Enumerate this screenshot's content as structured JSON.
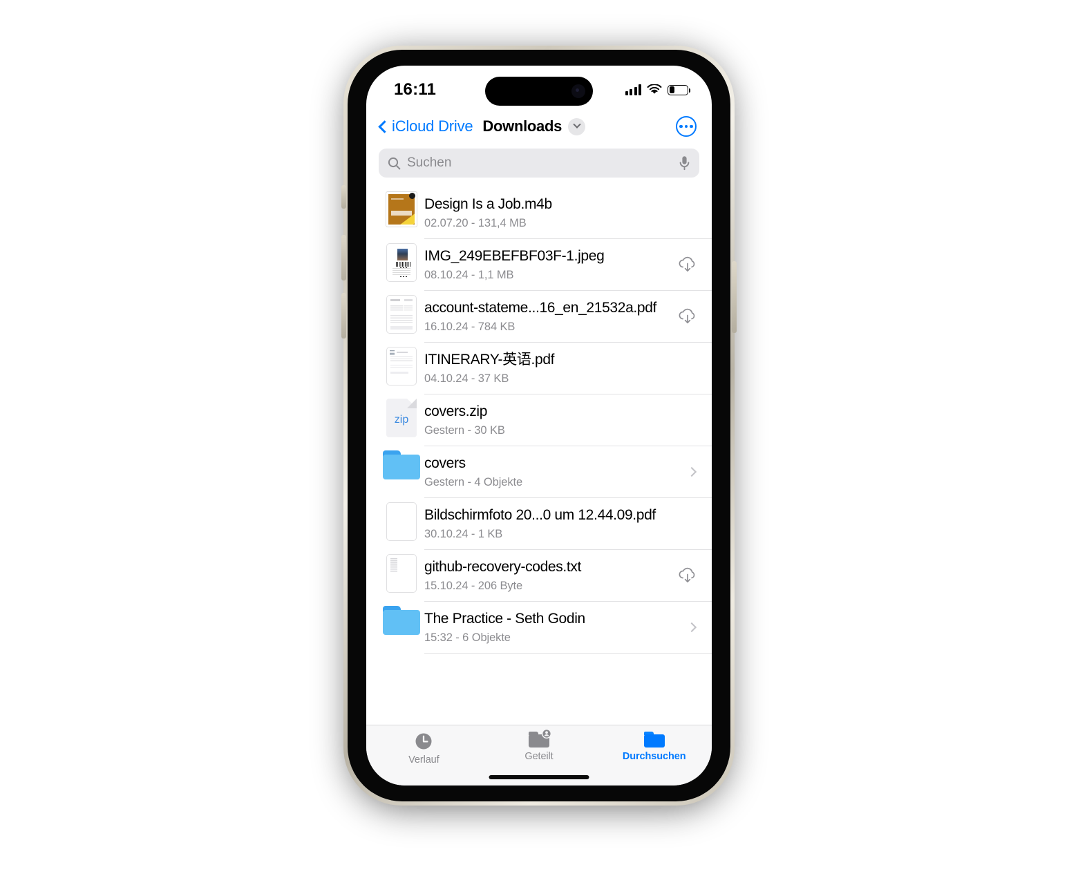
{
  "status_bar": {
    "time": "16:11",
    "signal_icon": "cellular-bars-icon",
    "wifi_icon": "wifi-icon",
    "battery_icon": "battery-icon",
    "battery_level_pct": 28
  },
  "nav": {
    "back_label": "iCloud Drive",
    "back_icon": "chevron-left-icon",
    "title": "Downloads",
    "title_chevron_icon": "chevron-down-icon",
    "more_icon": "ellipsis-circle-icon"
  },
  "search": {
    "placeholder": "Suchen",
    "search_icon": "search-icon",
    "mic_icon": "microphone-icon"
  },
  "files": [
    {
      "name": "Design Is a Job.m4b",
      "meta": "02.07.20 - 131,4 MB",
      "thumb": "audiobook-cover-thumbnail",
      "accessory": "none"
    },
    {
      "name": "IMG_249EBEFBF03F-1.jpeg",
      "meta": "08.10.24 - 1,1 MB",
      "thumb": "image-preview-thumbnail",
      "accessory": "cloud-download-icon"
    },
    {
      "name": "account-stateme...16_en_21532a.pdf",
      "meta": "16.10.24 - 784 KB",
      "thumb": "pdf-preview-thumbnail",
      "accessory": "cloud-download-icon"
    },
    {
      "name": "ITINERARY-英语.pdf",
      "meta": "04.10.24 - 37 KB",
      "thumb": "pdf-preview-thumbnail",
      "accessory": "none"
    },
    {
      "name": "covers.zip",
      "meta": "Gestern - 30 KB",
      "thumb": "zip-file-icon",
      "thumb_label": "zip",
      "accessory": "none"
    },
    {
      "name": "covers",
      "meta": "Gestern - 4 Objekte",
      "thumb": "folder-icon",
      "accessory": "chevron-right-icon"
    },
    {
      "name": "Bildschirmfoto 20...0 um 12.44.09.pdf",
      "meta": "30.10.24 - 1 KB",
      "thumb": "blank-document-thumbnail",
      "accessory": "none"
    },
    {
      "name": "github-recovery-codes.txt",
      "meta": "15.10.24 - 206 Byte",
      "thumb": "text-file-thumbnail",
      "accessory": "cloud-download-icon"
    },
    {
      "name": "The Practice - Seth Godin",
      "meta": "15:32 - 6 Objekte",
      "thumb": "folder-icon",
      "accessory": "chevron-right-icon"
    }
  ],
  "tabs": [
    {
      "label": "Verlauf",
      "icon": "clock-icon",
      "active": false
    },
    {
      "label": "Geteilt",
      "icon": "shared-folder-icon",
      "active": false
    },
    {
      "label": "Durchsuchen",
      "icon": "folder-icon",
      "active": true
    }
  ],
  "colors": {
    "accent": "#007aff",
    "folder_light": "#61c0f5",
    "folder_dark": "#3aa3ef",
    "secondary_text": "#8c8c90",
    "separator": "#e2e2e4",
    "search_bg": "#e9e9ec",
    "tabbar_bg": "#f7f7f8"
  }
}
